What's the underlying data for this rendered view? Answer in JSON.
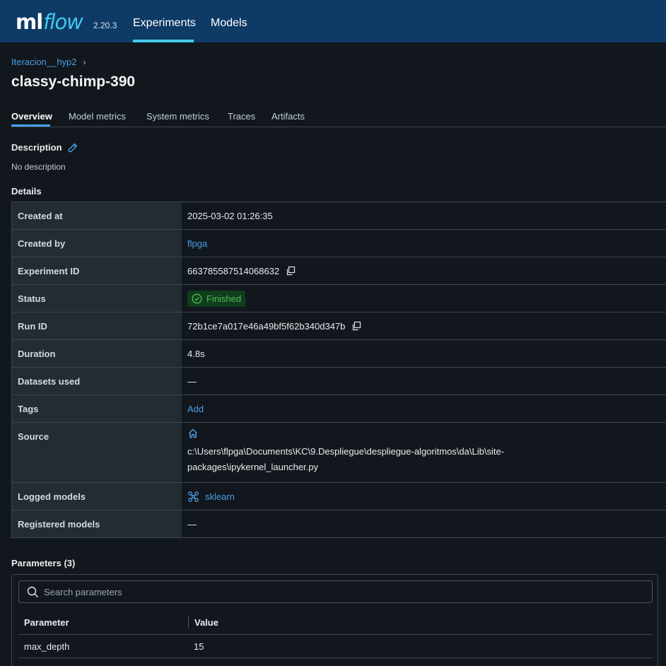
{
  "header": {
    "logo_ml": "ml",
    "logo_flow": "flow",
    "version": "2.20.3",
    "nav": [
      {
        "label": "Experiments",
        "active": true
      },
      {
        "label": "Models",
        "active": false
      }
    ],
    "colors": {
      "background": "#0e3a66",
      "accent": "#43c9ed"
    }
  },
  "breadcrumb": {
    "experiment": "Iteracion__hyp2",
    "separator_icon": "chevron-right-icon"
  },
  "title": "classy-chimp-390",
  "tabs": [
    {
      "label": "Overview",
      "active": true
    },
    {
      "label": "Model metrics",
      "active": false
    },
    {
      "label": "System metrics",
      "active": false
    },
    {
      "label": "Traces",
      "active": false
    },
    {
      "label": "Artifacts",
      "active": false
    }
  ],
  "description": {
    "heading": "Description",
    "text": "No description",
    "edit_icon": "pencil-icon"
  },
  "details": {
    "heading": "Details",
    "rows": {
      "created_at": {
        "key": "Created at",
        "value": "2025-03-02 01:26:35"
      },
      "created_by": {
        "key": "Created by",
        "value": "flpga"
      },
      "experiment_id": {
        "key": "Experiment ID",
        "value": "663785587514068632"
      },
      "status": {
        "key": "Status",
        "value": "Finished",
        "color": "#4cbf5a"
      },
      "run_id": {
        "key": "Run ID",
        "value": "72b1ce7a017e46a49bf5f62b340d347b"
      },
      "duration": {
        "key": "Duration",
        "value": "4.8s"
      },
      "datasets_used": {
        "key": "Datasets used",
        "value": "—"
      },
      "tags": {
        "key": "Tags",
        "value": "Add"
      },
      "source": {
        "key": "Source",
        "value": "c:\\Users\\flpga\\Documents\\KC\\9.Despliegue\\despliegue-algoritmos\\da\\Lib\\site-packages\\ipykernel_launcher.py",
        "line1": "c:\\Users\\flpga\\Documents\\KC\\9.Despliegue\\despliegue-algoritmos\\da\\Lib\\site-",
        "line2": "packages\\ipykernel_launcher.py"
      },
      "logged_models": {
        "key": "Logged models",
        "value": "sklearn"
      },
      "registered_models": {
        "key": "Registered models",
        "value": "—"
      }
    }
  },
  "parameters": {
    "heading": "Parameters (3)",
    "search_placeholder": "Search parameters",
    "columns": [
      "Parameter",
      "Value"
    ],
    "rows": [
      {
        "name": "max_depth",
        "value": "15"
      }
    ]
  }
}
